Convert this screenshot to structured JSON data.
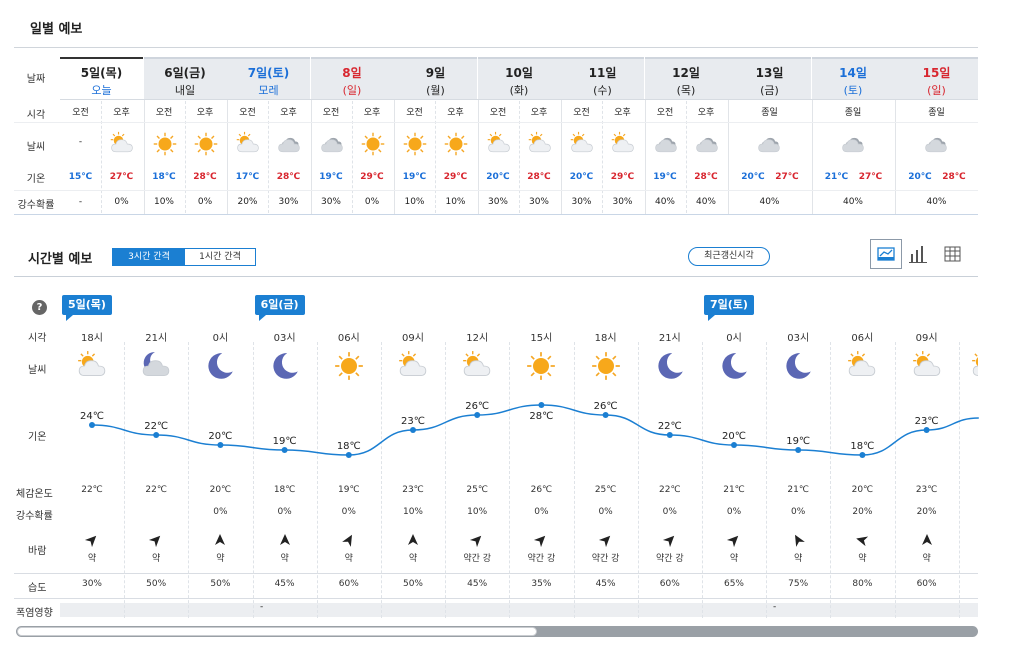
{
  "daily": {
    "title": "일별 예보",
    "row_labels": [
      "날짜",
      "시각",
      "날씨",
      "기온",
      "강수확률"
    ],
    "days": [
      {
        "d1": "5일(목)",
        "d2": "오늘",
        "type": "today",
        "split": true,
        "am": "오전",
        "pm": "오후",
        "w_am": "none",
        "w_pm": "sun-cloud-icon",
        "t_am": "15℃",
        "t_pm": "27℃",
        "p_am": "-",
        "p_pm": "0%",
        "am_text": "-"
      },
      {
        "d1": "6일(금)",
        "d2": "내일",
        "type": "weekday",
        "split": true,
        "am": "오전",
        "pm": "오후",
        "w_am": "sun-icon",
        "w_pm": "sun-icon",
        "t_am": "18℃",
        "t_pm": "28℃",
        "p_am": "10%",
        "p_pm": "0%"
      },
      {
        "d1": "7일(토)",
        "d2": "모레",
        "type": "sat",
        "split": true,
        "am": "오전",
        "pm": "오후",
        "w_am": "sun-cloud-icon",
        "w_pm": "cloud-icon",
        "t_am": "17℃",
        "t_pm": "28℃",
        "p_am": "20%",
        "p_pm": "30%"
      },
      {
        "d1": "8일",
        "d2": "(일)",
        "type": "sun",
        "split": true,
        "am": "오전",
        "pm": "오후",
        "w_am": "cloud-icon",
        "w_pm": "sun-icon",
        "t_am": "19℃",
        "t_pm": "29℃",
        "p_am": "30%",
        "p_pm": "0%"
      },
      {
        "d1": "9일",
        "d2": "(월)",
        "type": "weekday",
        "split": true,
        "am": "오전",
        "pm": "오후",
        "w_am": "sun-icon",
        "w_pm": "sun-icon",
        "t_am": "19℃",
        "t_pm": "29℃",
        "p_am": "10%",
        "p_pm": "10%"
      },
      {
        "d1": "10일",
        "d2": "(화)",
        "type": "weekday",
        "split": true,
        "am": "오전",
        "pm": "오후",
        "w_am": "sun-cloud-icon",
        "w_pm": "sun-cloud-icon",
        "t_am": "20℃",
        "t_pm": "28℃",
        "p_am": "30%",
        "p_pm": "30%"
      },
      {
        "d1": "11일",
        "d2": "(수)",
        "type": "weekday",
        "split": true,
        "am": "오전",
        "pm": "오후",
        "w_am": "sun-cloud-icon",
        "w_pm": "sun-cloud-icon",
        "t_am": "20℃",
        "t_pm": "29℃",
        "p_am": "30%",
        "p_pm": "30%"
      },
      {
        "d1": "12일",
        "d2": "(목)",
        "type": "weekday",
        "split": true,
        "am": "오전",
        "pm": "오후",
        "w_am": "cloud-icon",
        "w_pm": "cloud-icon",
        "t_am": "19℃",
        "t_pm": "28℃",
        "p_am": "40%",
        "p_pm": "40%"
      },
      {
        "d1": "13일",
        "d2": "(금)",
        "type": "weekday",
        "split": false,
        "all": "종일",
        "w_all": "cloud-icon",
        "t_am": "20℃",
        "t_pm": "27℃",
        "p_all": "40%"
      },
      {
        "d1": "14일",
        "d2": "(토)",
        "type": "sat",
        "split": false,
        "all": "종일",
        "w_all": "cloud-icon",
        "t_am": "21℃",
        "t_pm": "27℃",
        "p_all": "40%"
      },
      {
        "d1": "15일",
        "d2": "(일)",
        "type": "sun",
        "split": false,
        "all": "종일",
        "w_all": "cloud-icon",
        "t_am": "20℃",
        "t_pm": "28℃",
        "p_all": "40%"
      }
    ]
  },
  "hourly": {
    "title": "시간별 예보",
    "interval_3h": "3시간 간격",
    "interval_1h": "1시간 간격",
    "refresh_button": "최근갱신시각",
    "help_icon": "?",
    "day_tags": [
      {
        "label": "5일(목)",
        "col": 0
      },
      {
        "label": "6일(금)",
        "col": 3
      },
      {
        "label": "7일(토)",
        "col": 10
      }
    ],
    "row_labels": {
      "time": "시각",
      "weather": "날씨",
      "temp": "기온",
      "feels": "체감온도",
      "precip": "강수확률",
      "wind": "바람",
      "humidity": "습도",
      "heat": "폭염영향"
    },
    "times": [
      "18시",
      "21시",
      "0시",
      "03시",
      "06시",
      "09시",
      "12시",
      "15시",
      "18시",
      "21시",
      "0시",
      "03시",
      "06시",
      "09시"
    ],
    "icons": [
      "sun-cloud-icon",
      "moon-cloud-icon",
      "moon-icon",
      "moon-icon",
      "sun-icon",
      "sun-cloud-icon",
      "sun-cloud-icon",
      "sun-icon",
      "sun-icon",
      "moon-icon",
      "moon-icon",
      "moon-icon",
      "sun-cloud-icon",
      "sun-cloud-icon"
    ],
    "temps": [
      24,
      22,
      20,
      19,
      18,
      23,
      26,
      28,
      26,
      22,
      20,
      19,
      18,
      23
    ],
    "temp_labels": [
      "24℃",
      "22℃",
      "20℃",
      "19℃",
      "18℃",
      "23℃",
      "26℃",
      "28℃",
      "26℃",
      "22℃",
      "20℃",
      "19℃",
      "18℃",
      "23℃"
    ],
    "feels": [
      "22℃",
      "22℃",
      "20℃",
      "18℃",
      "19℃",
      "23℃",
      "25℃",
      "26℃",
      "25℃",
      "22℃",
      "21℃",
      "21℃",
      "20℃",
      "23℃"
    ],
    "precip": [
      "",
      "",
      "0%",
      "0%",
      "0%",
      "10%",
      "10%",
      "0%",
      "0%",
      "0%",
      "0%",
      "0%",
      "20%",
      "20%"
    ],
    "wind_dir_deg": [
      45,
      45,
      0,
      0,
      30,
      0,
      45,
      45,
      45,
      45,
      45,
      -30,
      -75,
      0
    ],
    "wind": [
      "약",
      "약",
      "약",
      "약",
      "약",
      "약",
      "약간 강",
      "약간 강",
      "약간 강",
      "약간 강",
      "약",
      "약",
      "약",
      "약"
    ],
    "humidity": [
      "30%",
      "50%",
      "50%",
      "45%",
      "60%",
      "50%",
      "45%",
      "35%",
      "45%",
      "60%",
      "65%",
      "75%",
      "80%",
      "60%"
    ],
    "heat_impact": [
      "-",
      "-"
    ]
  }
}
